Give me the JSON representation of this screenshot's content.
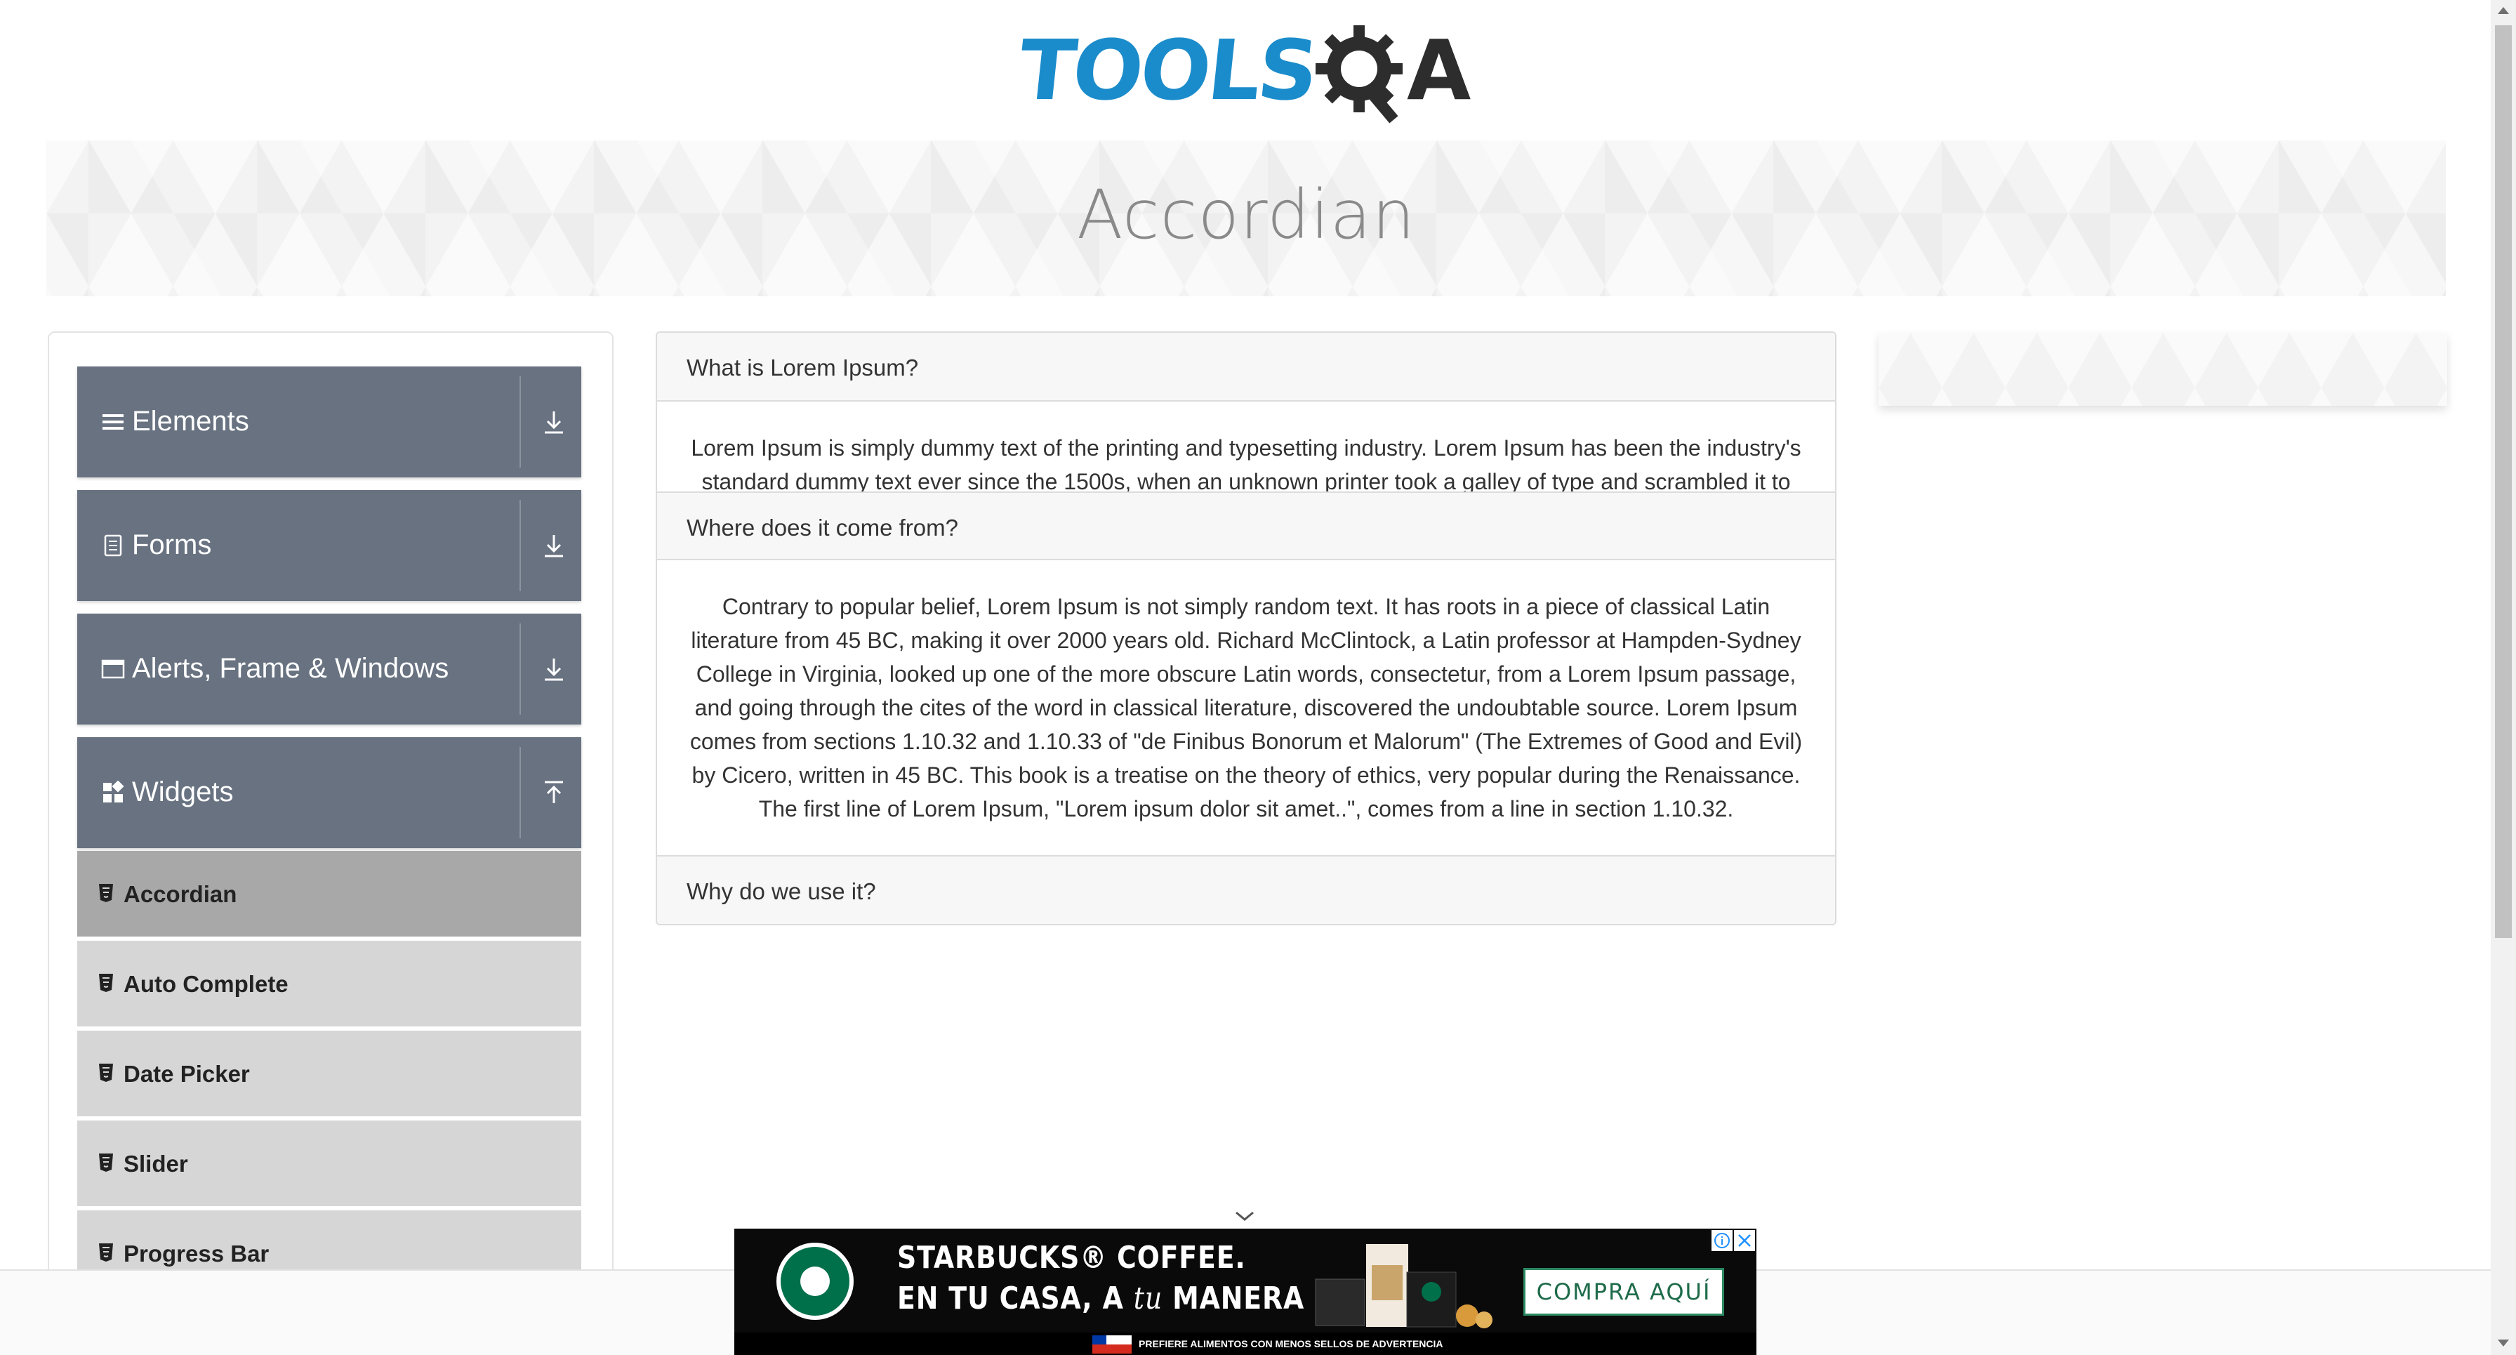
{
  "header": {
    "logo_text_left": "TOOLS",
    "logo_text_right": "A",
    "logo_colors": {
      "tools": "#1b8ccb",
      "gear": "#2d2d2d"
    }
  },
  "banner": {
    "title": "Accordian"
  },
  "sidebar": {
    "groups": [
      {
        "label": "Elements",
        "icon": "hamburger-icon",
        "expanded": false
      },
      {
        "label": "Forms",
        "icon": "document-icon",
        "expanded": false
      },
      {
        "label": "Alerts, Frame & Windows",
        "icon": "window-icon",
        "expanded": false
      },
      {
        "label": "Widgets",
        "icon": "widgets-icon",
        "expanded": true
      }
    ],
    "widget_items": [
      {
        "label": "Accordian",
        "active": true
      },
      {
        "label": "Auto Complete",
        "active": false
      },
      {
        "label": "Date Picker",
        "active": false
      },
      {
        "label": "Slider",
        "active": false
      },
      {
        "label": "Progress Bar",
        "active": false
      }
    ],
    "colors": {
      "group_bg": "#687281",
      "item_bg": "#d6d6d6",
      "item_active_bg": "#a8a8a8"
    }
  },
  "accordion": {
    "sections": [
      {
        "header": "What is Lorem Ipsum?",
        "body": "Lorem Ipsum is simply dummy text of the printing and typesetting industry. Lorem Ipsum has been the industry's standard dummy text ever since the 1500s, when an unknown printer took a galley of type and scrambled it to"
      },
      {
        "header": "Where does it come from?",
        "body": "Contrary to popular belief, Lorem Ipsum is not simply random text. It has roots in a piece of classical Latin literature from 45 BC, making it over 2000 years old. Richard McClintock, a Latin professor at Hampden-Sydney College in Virginia, looked up one of the more obscure Latin words, consectetur, from a Lorem Ipsum passage, and going through the cites of the word in classical literature, discovered the undoubtable source. Lorem Ipsum comes from sections 1.10.32 and 1.10.33 of \"de Finibus Bonorum et Malorum\" (The Extremes of Good and Evil) by Cicero, written in 45 BC. This book is a treatise on the theory of ethics, very popular during the Renaissance. The first line of Lorem Ipsum, \"Lorem ipsum dolor sit amet..\", comes from a line in section 1.10.32."
      },
      {
        "header": "Why do we use it?"
      }
    ]
  },
  "ad": {
    "headline_line1": "STARBUCKS® COFFEE.",
    "headline_line2_prefix": "EN TU CASA, A ",
    "headline_line2_italic": "tu",
    "headline_line2_suffix": " MANERA",
    "cta": "COMPRA AQUÍ",
    "disclaimer": "PREFIERE ALIMENTOS CON MENOS SELLOS DE ADVERTENCIA",
    "brand_color": "#00704a"
  }
}
